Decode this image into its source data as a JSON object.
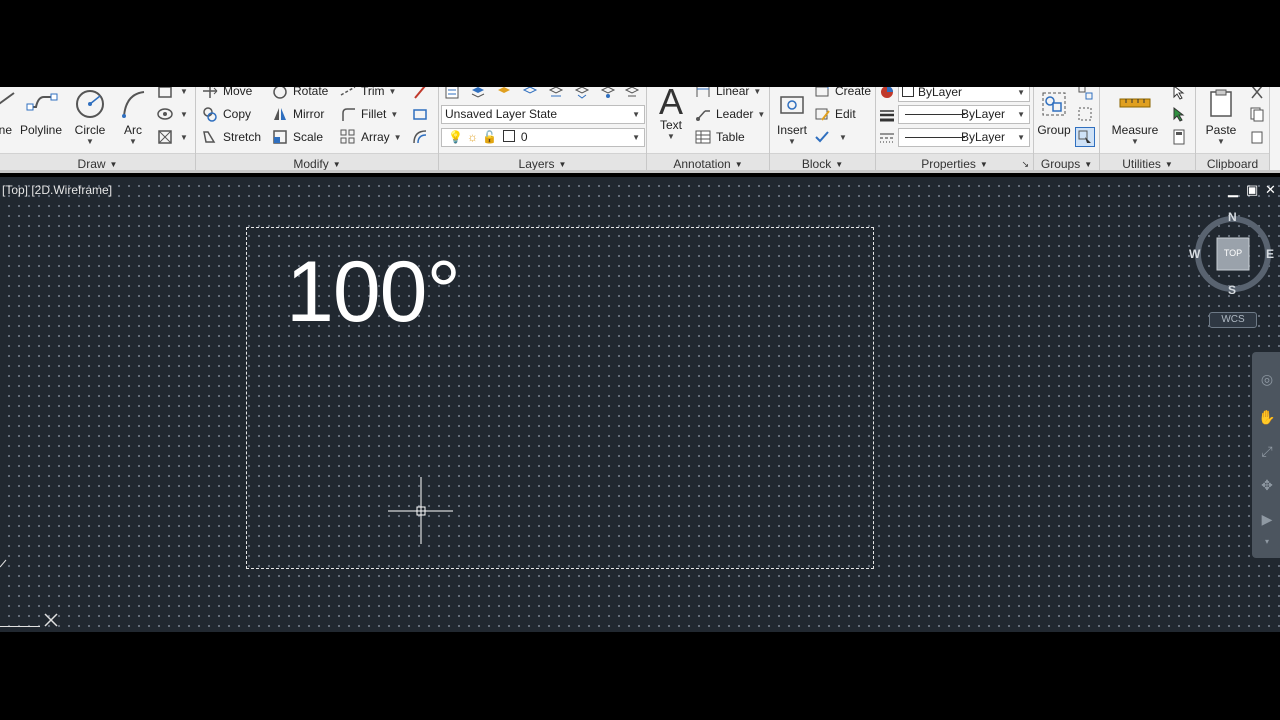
{
  "ribbon": {
    "draw": {
      "title": "Draw",
      "partial_label": "ne",
      "polyline": "Polyline",
      "circle": "Circle",
      "arc": "Arc"
    },
    "modify": {
      "title": "Modify",
      "move": "Move",
      "rotate": "Rotate",
      "trim": "Trim",
      "copy": "Copy",
      "mirror": "Mirror",
      "fillet": "Fillet",
      "stretch": "Stretch",
      "scale": "Scale",
      "array": "Array"
    },
    "layers": {
      "title": "Layers",
      "layer_state": "Unsaved Layer State",
      "current_layer": "0"
    },
    "annotation": {
      "title": "Annotation",
      "text": "Text",
      "text_glyph": "A",
      "linear": "Linear",
      "leader": "Leader",
      "table": "Table"
    },
    "block": {
      "title": "Block",
      "insert": "Insert",
      "create": "Create",
      "edit": "Edit"
    },
    "properties": {
      "title": "Properties",
      "color": "ByLayer",
      "lineweight": "ByLayer",
      "linetype": "ByLayer"
    },
    "groups": {
      "title": "Groups",
      "group": "Group"
    },
    "utilities": {
      "title": "Utilities",
      "measure": "Measure"
    },
    "clipboard": {
      "title": "Clipboard",
      "paste": "Paste"
    }
  },
  "viewport": {
    "label": "[Top] [2D.Wireframe]",
    "drawing_text": "100°",
    "viewcube": {
      "face": "TOP",
      "north": "N",
      "south": "S",
      "east": "E",
      "west": "W",
      "wcs": "WCS"
    }
  },
  "colors": {
    "ribbon_bg": "#f4f4f4",
    "panel_title_bg": "#e4e4e4",
    "viewport_bg": "#212830",
    "grid_dot": "#6c7582",
    "highlight_blue": "#2f6fbf"
  }
}
